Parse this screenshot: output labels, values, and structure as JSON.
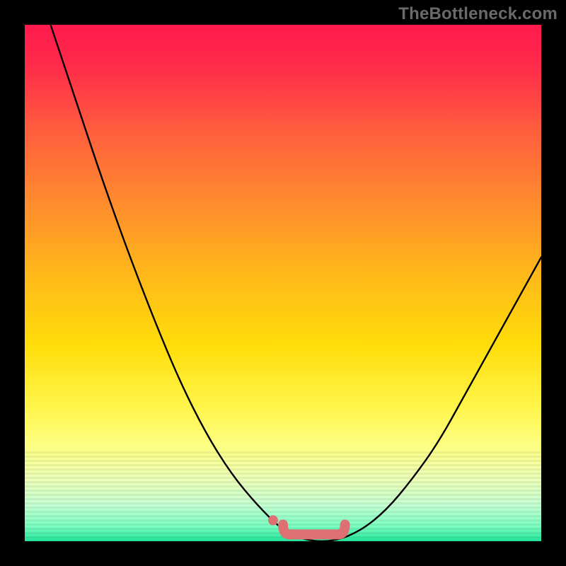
{
  "watermark": "TheBottleneck.com",
  "colors": {
    "background": "#000000",
    "curve_stroke": "#000000",
    "marker_fill": "#de6f73",
    "gradient_stops": [
      "#ff1a4d",
      "#ff2b4a",
      "#ff5c3e",
      "#ff8a2e",
      "#ffb71a",
      "#ffdd0a",
      "#fff54a",
      "#fcff86",
      "#ecffb8",
      "#c4ffd2",
      "#7effc2",
      "#22e59a"
    ]
  },
  "chart_data": {
    "type": "line",
    "title": "",
    "xlabel": "",
    "ylabel": "",
    "xlim": [
      0,
      1
    ],
    "ylim": [
      0,
      1
    ],
    "series": [
      {
        "name": "bottleneck-curve",
        "x": [
          0.05,
          0.1,
          0.15,
          0.2,
          0.25,
          0.3,
          0.35,
          0.4,
          0.45,
          0.5,
          0.55,
          0.6,
          0.65,
          0.7,
          0.75,
          0.8,
          0.85,
          0.9,
          0.95,
          1.0
        ],
        "y": [
          1.0,
          0.85,
          0.7,
          0.56,
          0.43,
          0.31,
          0.21,
          0.13,
          0.07,
          0.02,
          0.0,
          0.0,
          0.02,
          0.06,
          0.12,
          0.19,
          0.28,
          0.37,
          0.46,
          0.55
        ]
      }
    ],
    "markers": {
      "name": "highlighted-range",
      "x_start": 0.5,
      "x_end": 0.62,
      "y": 0.005
    }
  }
}
